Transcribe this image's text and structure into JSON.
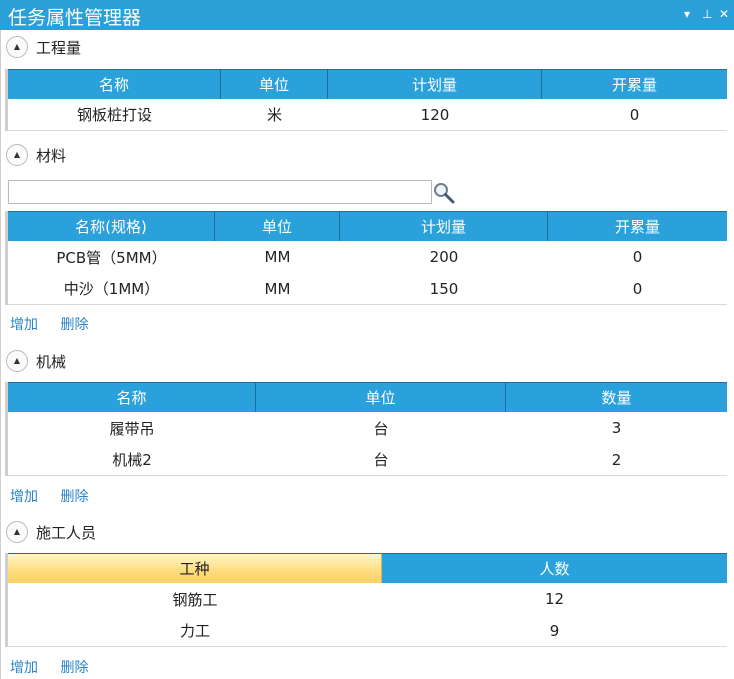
{
  "window": {
    "title": "任务属性管理器",
    "controls": [
      "▾",
      "⊥",
      "✕"
    ]
  },
  "sections": {
    "quantity": {
      "title": "工程量",
      "columns": [
        "名称",
        "单位",
        "计划量",
        "开累量"
      ],
      "rows": [
        [
          "钢板桩打设",
          "米",
          "120",
          "0"
        ]
      ]
    },
    "material": {
      "title": "材料",
      "search_value": "",
      "columns": [
        "名称(规格)",
        "单位",
        "计划量",
        "开累量"
      ],
      "rows": [
        [
          "PCB管（5MM）",
          "MM",
          "200",
          "0"
        ],
        [
          "中沙（1MM）",
          "MM",
          "150",
          "0"
        ]
      ],
      "add_label": "增加",
      "delete_label": "删除"
    },
    "machinery": {
      "title": "机械",
      "columns": [
        "名称",
        "单位",
        "数量"
      ],
      "rows": [
        [
          "履带吊",
          "台",
          "3"
        ],
        [
          "机械2",
          "台",
          "2"
        ]
      ],
      "add_label": "增加",
      "delete_label": "删除"
    },
    "workers": {
      "title": "施工人员",
      "columns": [
        "工种",
        "人数"
      ],
      "rows": [
        [
          "钢筋工",
          "12"
        ],
        [
          "力工",
          "9"
        ]
      ],
      "add_label": "增加",
      "delete_label": "删除"
    }
  },
  "colors": {
    "accent": "#2a9fd8",
    "header_bg": "#2aa1db",
    "selected_header": "#fddc7a",
    "link": "#2a86c8"
  }
}
